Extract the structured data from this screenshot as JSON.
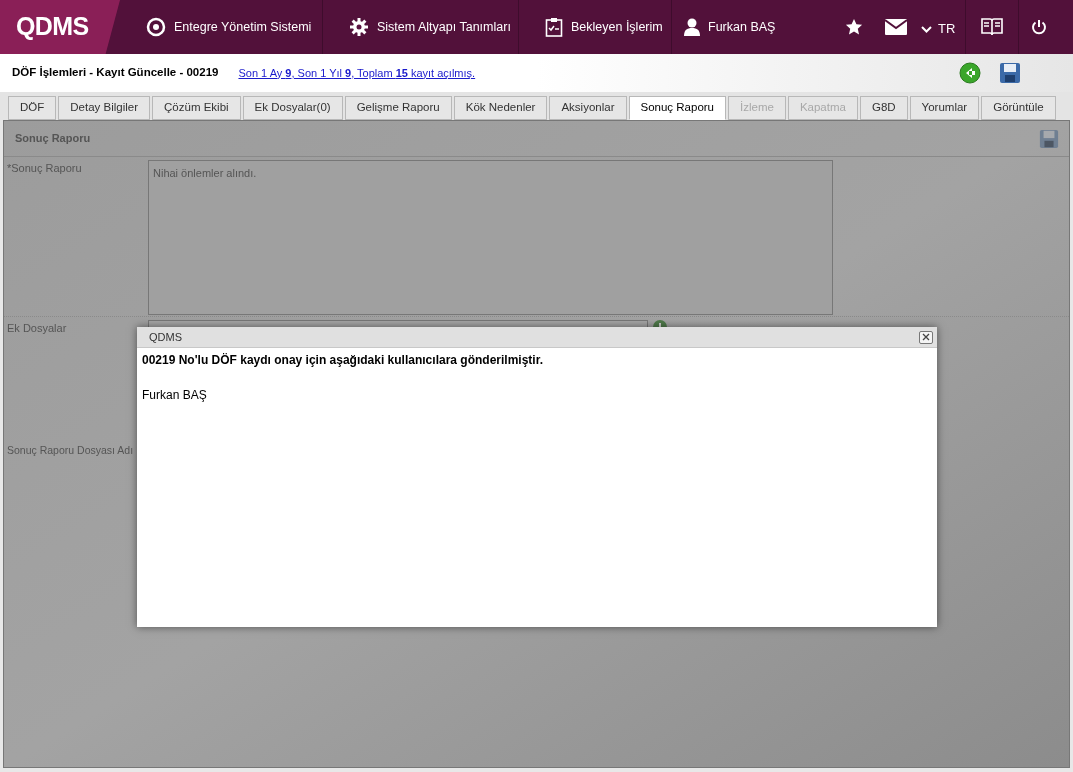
{
  "header": {
    "logo": "QDMS",
    "nav": [
      {
        "label": "Entegre Yönetim Sistemi"
      },
      {
        "label": "Sistem Altyapı Tanımları"
      },
      {
        "label": "Bekleyen İşlerim"
      }
    ],
    "user": "Furkan BAŞ",
    "language": "TR"
  },
  "title_bar": {
    "title": "DÖF İşlemleri - Kayıt Güncelle - 00219",
    "link": "Son 1 Ay **9**, Son 1 Yıl **9**, Toplam **15** kayıt açılmış."
  },
  "tabs": [
    {
      "label": "DÖF",
      "selected": false,
      "disabled": false
    },
    {
      "label": "Detay Bilgiler",
      "selected": false,
      "disabled": false
    },
    {
      "label": "Çözüm Ekibi",
      "selected": false,
      "disabled": false
    },
    {
      "label": "Ek Dosyalar(0)",
      "selected": false,
      "disabled": false
    },
    {
      "label": "Gelişme Raporu",
      "selected": false,
      "disabled": false
    },
    {
      "label": "Kök Nedenler",
      "selected": false,
      "disabled": false
    },
    {
      "label": "Aksiyonlar",
      "selected": false,
      "disabled": false
    },
    {
      "label": "Sonuç Raporu",
      "selected": true,
      "disabled": false
    },
    {
      "label": "İzleme",
      "selected": false,
      "disabled": true
    },
    {
      "label": "Kapatma",
      "selected": false,
      "disabled": true
    },
    {
      "label": "G8D",
      "selected": false,
      "disabled": false
    },
    {
      "label": "Yorumlar",
      "selected": false,
      "disabled": false
    },
    {
      "label": "Görüntüle",
      "selected": false,
      "disabled": false
    }
  ],
  "section": {
    "title": "Sonuç Raporu",
    "report_label": "*Sonuç Raporu",
    "report_value": "Nihai önlemler alındı.",
    "files_label": "Ek Dosyalar",
    "file_name_label": "Sonuç Raporu Dosyası Adı"
  },
  "dialog": {
    "title": "QDMS",
    "message": "00219 No'lu DÖF kaydı onay için aşağıdaki kullanıcılara gönderilmiştir.",
    "recipients": [
      "Furkan BAŞ"
    ]
  }
}
